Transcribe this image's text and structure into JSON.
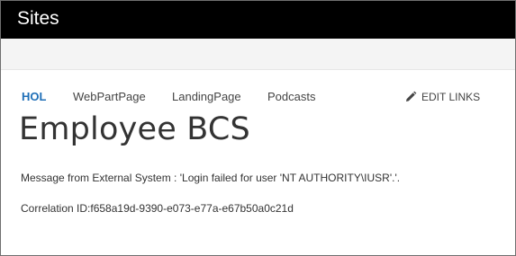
{
  "suite_bar": {
    "title": "Sites"
  },
  "top_nav": {
    "items": [
      {
        "label": "HOL",
        "selected": true
      },
      {
        "label": "WebPartPage",
        "selected": false
      },
      {
        "label": "LandingPage",
        "selected": false
      },
      {
        "label": "Podcasts",
        "selected": false
      }
    ],
    "edit_links": {
      "label": "EDIT LINKS",
      "icon": "pencil-icon"
    }
  },
  "page": {
    "title": "Employee BCS",
    "message": "Message from External System : 'Login failed for user 'NT AUTHORITY\\IUSR'.'.",
    "correlation": "Correlation ID:f658a19d-9390-e073-e77a-e67b50a0c21d"
  },
  "colors": {
    "suite_bar": "#000000",
    "ribbon": "#f4f4f4",
    "selected_nav": "#1f6fb7",
    "text": "#333333"
  }
}
